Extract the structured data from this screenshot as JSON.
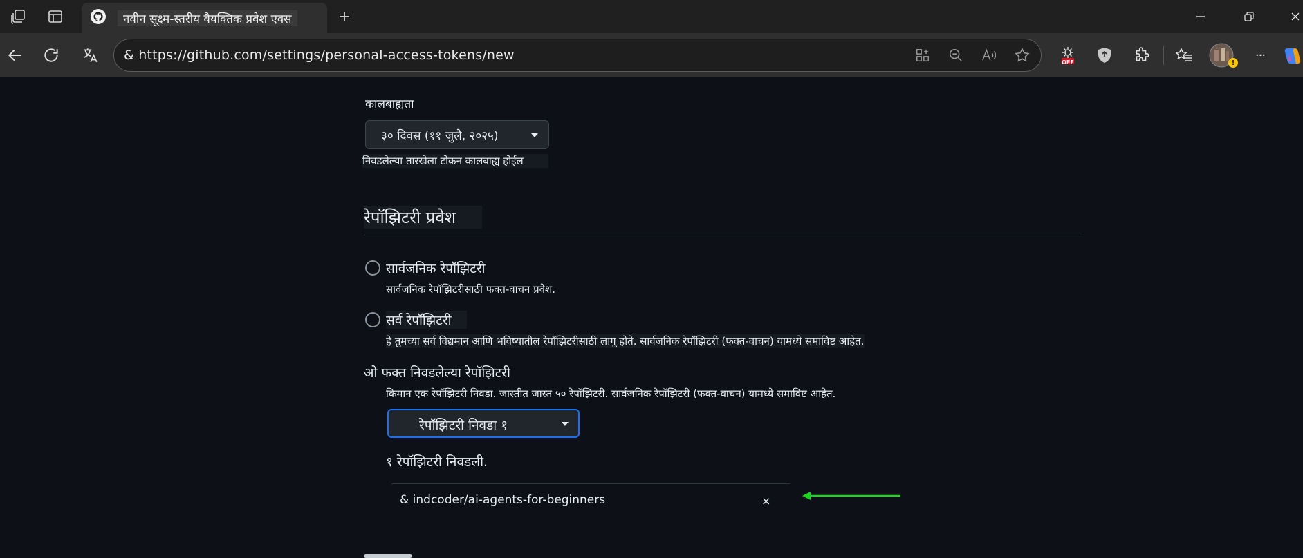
{
  "browser": {
    "tab_title": "नवीन सूक्ष्म-स्तरीय वैयक्तिक प्रवेश एक्स",
    "new_tab_label": "+",
    "url": "& https://github.com/settings/personal-access-tokens/new",
    "tracker_badge": "OFF",
    "more_label": "···",
    "colors": {
      "tabbar": "#202020",
      "toolbar": "#2f2f2f",
      "badge": "#e81123"
    }
  },
  "expiration": {
    "label": "कालबाह्यता",
    "selected": "३० दिवस (११ जुलै, २०२५)",
    "note": "निवडलेल्या तारखेला टोकन कालबाह्य होईल"
  },
  "repo_access": {
    "heading": "रेपॉझिटरी प्रवेश",
    "options": [
      {
        "label": "सार्वजनिक रेपॉझिटरी",
        "description": "सार्वजनिक रेपॉझिटरीसाठी फक्त-वाचन प्रवेश."
      },
      {
        "label": "सर्व रेपॉझिटरी",
        "description": "हे तुमच्या सर्व विद्यमान आणि भविष्यातील रेपॉझिटरीसाठी लागू होते. सार्वजनिक रेपॉझिटरी (फक्त-वाचन) यामध्ये समाविष्ट आहेत."
      },
      {
        "label": "ओ फक्त निवडलेल्या रेपॉझिटरी",
        "description": "किमान एक रेपॉझिटरी निवडा. जास्तीत जास्त ५० रेपॉझिटरी. सार्वजनिक रेपॉझिटरी (फक्त-वाचन) यामध्ये समाविष्ट आहेत."
      }
    ],
    "select_button": "रेपॉझिटरी निवडा १",
    "selected_count": "१ रेपॉझिटरी निवडली.",
    "selected_repo": "& indcoder/ai-agents-for-beginners",
    "remove_label": "×",
    "arrow_color": "#1fd61f"
  }
}
